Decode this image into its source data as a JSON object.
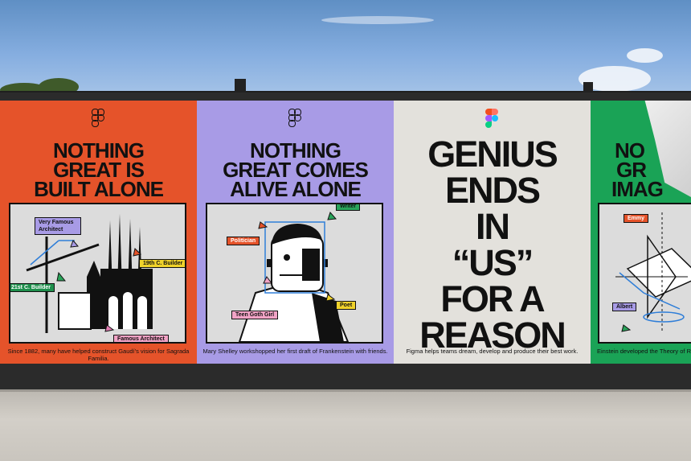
{
  "posters": [
    {
      "headline_lines": [
        "NOTHING",
        "GREAT IS",
        "BUILT ALONE"
      ],
      "tags": [
        "Very Famous Architect",
        "19th C. Builder",
        "21st C. Builder",
        "Famous Architect"
      ],
      "caption": "Since 1882, many have helped construct Gaudí's vision for Sagrada Familia.",
      "background": "#e5532a"
    },
    {
      "headline_lines": [
        "NOTHING",
        "GREAT COMES",
        "ALIVE ALONE"
      ],
      "tags": [
        "Writer",
        "Politician",
        "Teen Goth Girl",
        "Poet"
      ],
      "caption": "Mary Shelley workshopped her first draft of Frankenstein with friends.",
      "background": "#a89be6"
    },
    {
      "headline_lines": [
        "GENIUS",
        "ENDS",
        "IN",
        "“US”",
        "FOR A",
        "REASON"
      ],
      "caption": "Figma helps teams dream, develop and produce their best work.",
      "background": "#e3e1dc"
    },
    {
      "headline_lines": [
        "NO",
        "GR",
        "IMAG"
      ],
      "tags": [
        "Emmy",
        "Albert"
      ],
      "caption": "Einstein developed the Theory of Rela",
      "background": "#1aa356"
    }
  ]
}
